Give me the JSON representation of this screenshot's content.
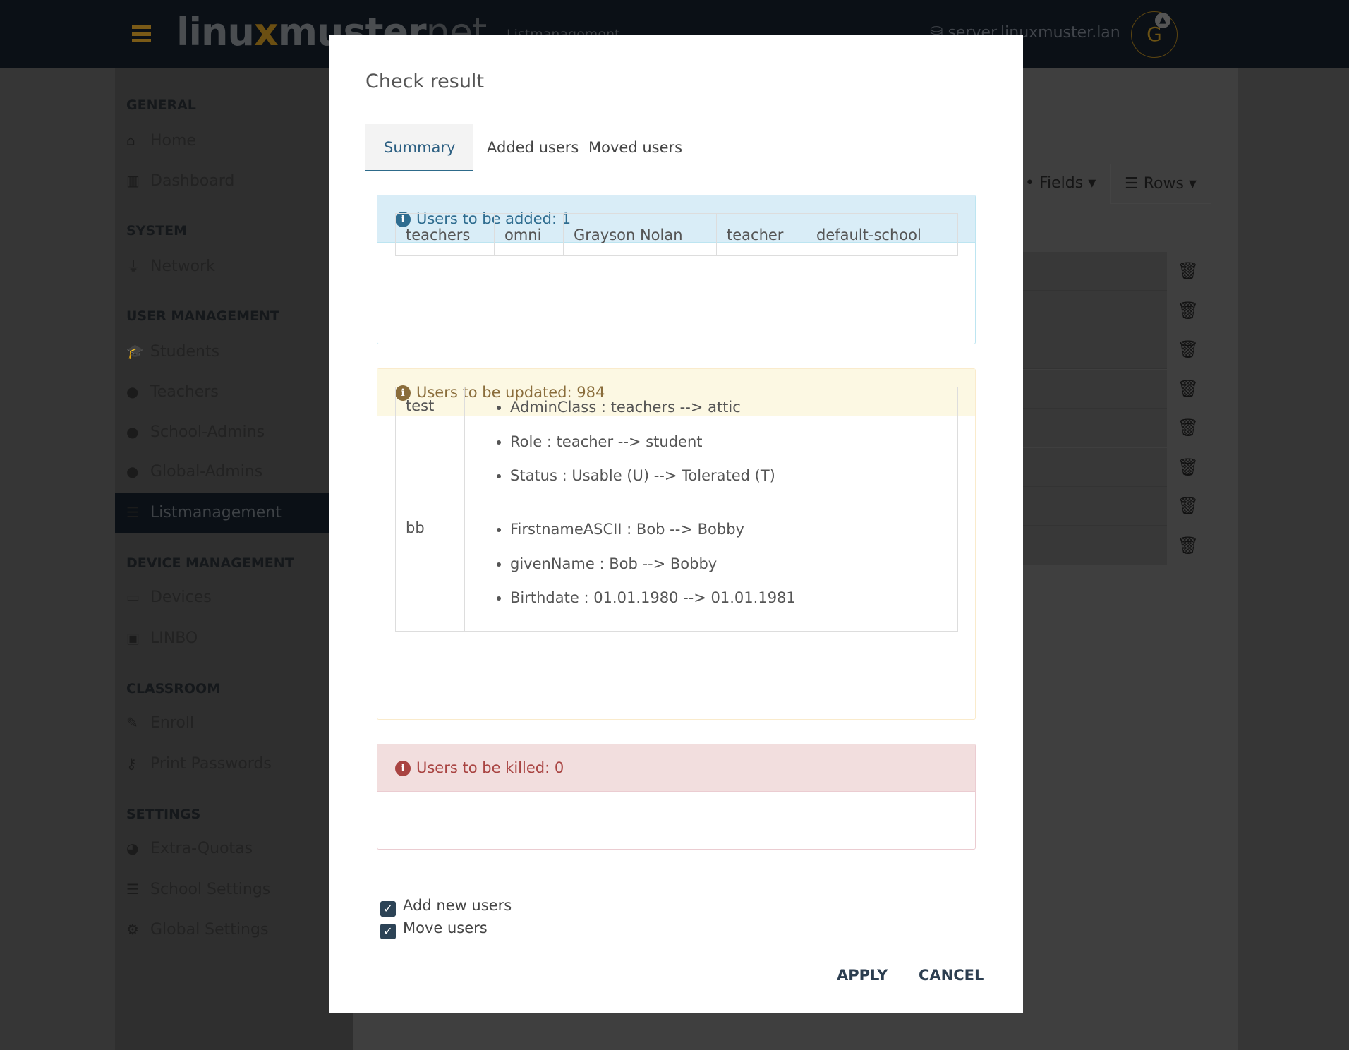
{
  "header": {
    "logo": "linuxmuster.net",
    "logo_parts": [
      "linu",
      "x",
      "muster",
      "net"
    ],
    "breadcrumb": "Listmanagement",
    "server": "server.linuxmuster.lan",
    "avatar_letter": "G"
  },
  "sidebar": {
    "sections": [
      {
        "title": "GENERAL",
        "items": [
          {
            "label": "Home",
            "icon": "home-icon"
          },
          {
            "label": "Dashboard",
            "icon": "chart-icon"
          }
        ]
      },
      {
        "title": "SYSTEM",
        "items": [
          {
            "label": "Network",
            "icon": "plug-icon"
          }
        ]
      },
      {
        "title": "USER MANAGEMENT",
        "items": [
          {
            "label": "Students",
            "icon": "graduation-icon"
          },
          {
            "label": "Teachers",
            "icon": "user-icon"
          },
          {
            "label": "School-Admins",
            "icon": "user-ninja-icon"
          },
          {
            "label": "Global-Admins",
            "icon": "user-astronaut-icon"
          },
          {
            "label": "Listmanagement",
            "icon": "list-icon",
            "active": true
          }
        ]
      },
      {
        "title": "DEVICE MANAGEMENT",
        "items": [
          {
            "label": "Devices",
            "icon": "laptop-icon"
          },
          {
            "label": "LINBO",
            "icon": "linbo-icon"
          }
        ]
      },
      {
        "title": "CLASSROOM",
        "items": [
          {
            "label": "Enroll",
            "icon": "edit-icon"
          },
          {
            "label": "Print Passwords",
            "icon": "key-icon"
          }
        ]
      },
      {
        "title": "SETTINGS",
        "items": [
          {
            "label": "Extra-Quotas",
            "icon": "pie-icon"
          },
          {
            "label": "School Settings",
            "icon": "sliders-icon"
          },
          {
            "label": "Global Settings",
            "icon": "cogs-icon"
          }
        ]
      }
    ]
  },
  "main": {
    "fields_label": "Fields",
    "rows_label": "Rows"
  },
  "modal": {
    "title": "Check result",
    "tabs": [
      {
        "label": "Summary",
        "active": true
      },
      {
        "label": "Added users"
      },
      {
        "label": "Moved users"
      }
    ],
    "added": {
      "title": "Users to be added: 1",
      "rows": [
        [
          "teachers",
          "omni",
          "Grayson Nolan",
          "teacher",
          "default-school"
        ]
      ]
    },
    "updated": {
      "title": "Users to be updated: 984",
      "rows": [
        {
          "user": "test",
          "changes": [
            "AdminClass : teachers --> attic",
            "Role : teacher --> student",
            "Status : Usable (U) --> Tolerated (T)"
          ]
        },
        {
          "user": "bb",
          "changes": [
            "FirstnameASCII : Bob --> Bobby",
            "givenName : Bob --> Bobby",
            "Birthdate : 01.01.1980 --> 01.01.1981"
          ]
        }
      ]
    },
    "killed": {
      "title": "Users to be killed: 0"
    },
    "options": [
      {
        "label": "Add new users",
        "checked": true
      },
      {
        "label": "Move users",
        "checked": true
      }
    ],
    "apply": "APPLY",
    "cancel": "CANCEL"
  },
  "colors": {
    "info": "#2f6d90",
    "warning": "#8a6d3b",
    "danger": "#a94442",
    "header_bg": "#0b1016"
  }
}
